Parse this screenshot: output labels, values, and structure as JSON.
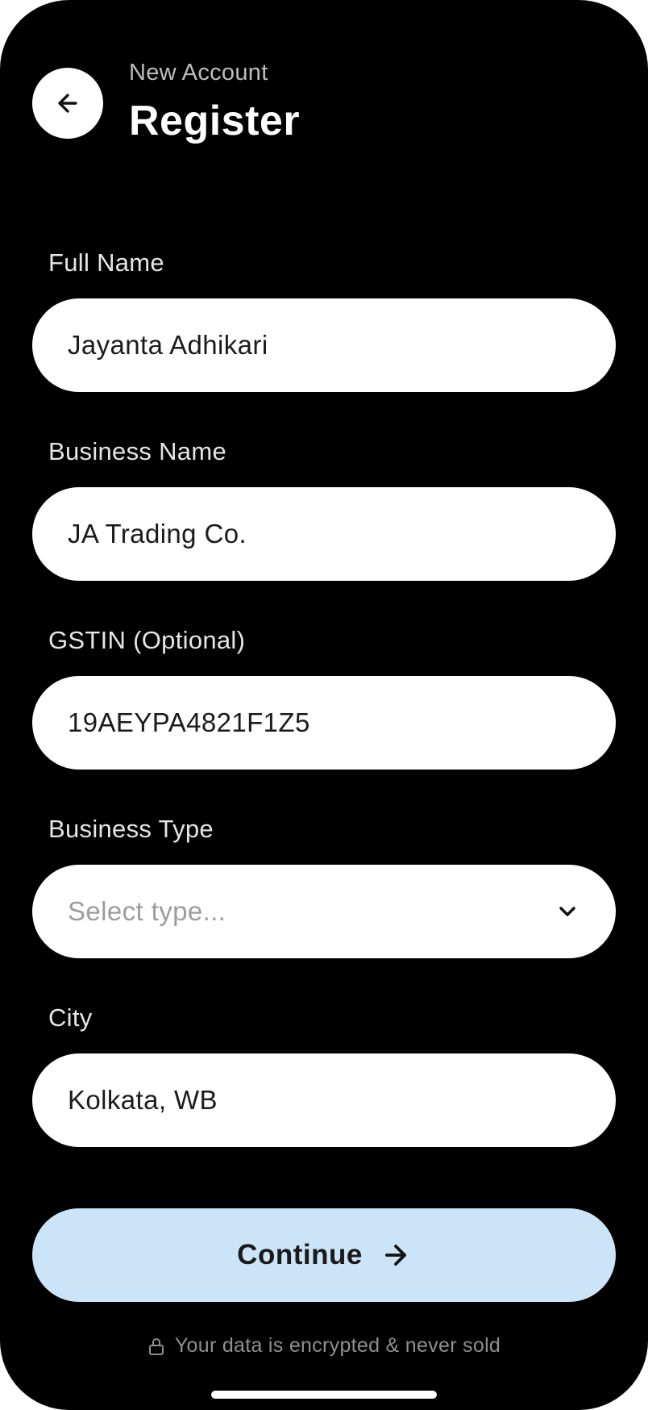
{
  "header": {
    "subtitle": "New Account",
    "title": "Register",
    "back_icon": "arrow-left-icon"
  },
  "form": {
    "full_name": {
      "label": "Full Name",
      "value": "Jayanta Adhikari"
    },
    "business_name": {
      "label": "Business Name",
      "value": "JA Trading Co."
    },
    "gstin": {
      "label": "GSTIN (Optional)",
      "value": "19AEYPA4821F1Z5"
    },
    "business_type": {
      "label": "Business Type",
      "placeholder": "Select type...",
      "icon": "chevron-down-icon"
    },
    "city": {
      "label": "City",
      "value": "Kolkata, WB"
    }
  },
  "actions": {
    "continue_label": "Continue",
    "continue_icon": "arrow-right-icon"
  },
  "footer": {
    "privacy_note": "Your data is encrypted & never sold",
    "privacy_icon": "lock-icon"
  },
  "colors": {
    "background": "#000000",
    "field_background": "#ffffff",
    "primary_button": "#cbe4f7",
    "label_text": "#e6e6e6",
    "muted_text": "#8f8f8f"
  }
}
